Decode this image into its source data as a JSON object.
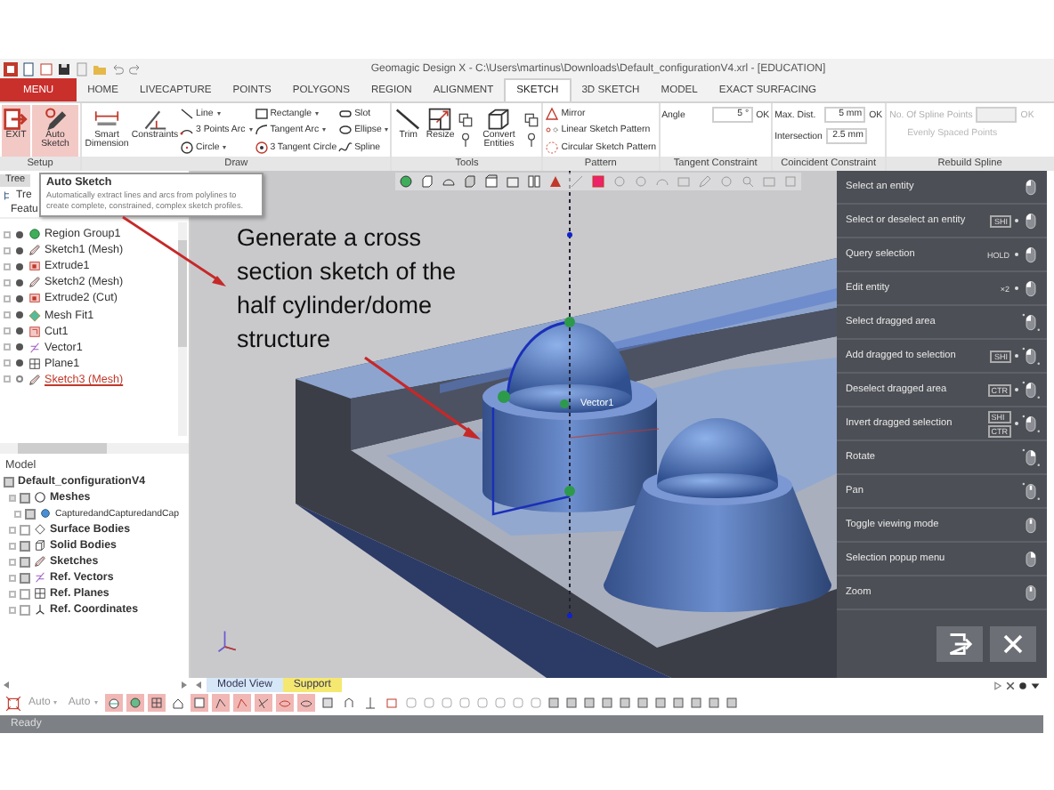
{
  "window": {
    "title": "Geomagic Design X - C:\\Users\\martinus\\Downloads\\Default_configurationV4.xrl - [EDUCATION]"
  },
  "ribbon_tabs": [
    {
      "label": "MENU",
      "kind": "menu",
      "selected": false
    },
    {
      "label": "HOME",
      "kind": "tab",
      "selected": false
    },
    {
      "label": "LIVECAPTURE",
      "kind": "tab",
      "selected": false
    },
    {
      "label": "POINTS",
      "kind": "tab",
      "selected": false
    },
    {
      "label": "POLYGONS",
      "kind": "tab",
      "selected": false
    },
    {
      "label": "REGION",
      "kind": "tab",
      "selected": false
    },
    {
      "label": "ALIGNMENT",
      "kind": "tab",
      "selected": false
    },
    {
      "label": "SKETCH",
      "kind": "tab",
      "selected": true
    },
    {
      "label": "3D SKETCH",
      "kind": "tab",
      "selected": false
    },
    {
      "label": "MODEL",
      "kind": "tab",
      "selected": false
    },
    {
      "label": "EXACT SURFACING",
      "kind": "tab",
      "selected": false
    }
  ],
  "ribbon_groups": [
    {
      "title": "Setup",
      "items": [
        {
          "kind": "large",
          "label": "EXIT",
          "highlighted": true
        },
        {
          "kind": "large",
          "label": "Auto Sketch",
          "highlighted": true
        }
      ]
    },
    {
      "title": "Draw",
      "items": [
        {
          "kind": "large",
          "label": "Smart Dimension",
          "highlighted": false
        },
        {
          "kind": "large",
          "label": "Constraints",
          "highlighted": false
        },
        {
          "kind": "stack",
          "buttons": [
            {
              "label": "Line",
              "dropdown": true
            },
            {
              "label": "3 Points Arc",
              "dropdown": true
            },
            {
              "label": "Circle",
              "dropdown": true
            }
          ]
        },
        {
          "kind": "stack",
          "buttons": [
            {
              "label": "Rectangle",
              "dropdown": true
            },
            {
              "label": "Tangent Arc",
              "dropdown": true
            },
            {
              "label": "3 Tangent Circle",
              "dropdown": false
            }
          ]
        },
        {
          "kind": "stack",
          "buttons": [
            {
              "label": "Slot",
              "dropdown": false
            },
            {
              "label": "Ellipse",
              "dropdown": true
            },
            {
              "label": "Spline",
              "dropdown": false
            }
          ]
        }
      ]
    },
    {
      "title": "Tools",
      "items": [
        {
          "kind": "large",
          "label": "Trim",
          "highlighted": false
        },
        {
          "kind": "large",
          "label": "Resize",
          "highlighted": false
        },
        {
          "kind": "icon_stack"
        },
        {
          "kind": "large",
          "label": "Convert Entities",
          "highlighted": false
        },
        {
          "kind": "icon_stack"
        }
      ]
    },
    {
      "title": "Pattern",
      "items": [
        {
          "kind": "stack",
          "buttons": [
            {
              "label": "Mirror",
              "dropdown": false
            },
            {
              "label": "Linear Sketch Pattern",
              "dropdown": false
            },
            {
              "label": "Circular Sketch Pattern",
              "dropdown": false
            }
          ]
        }
      ]
    },
    {
      "title": "Tangent Constraint",
      "items": [
        {
          "kind": "form",
          "rows": [
            {
              "kind": "field",
              "label": "Angle",
              "value": "5 °",
              "button": "OK",
              "disabled": false
            }
          ]
        }
      ]
    },
    {
      "title": "Coincident Constraint",
      "items": [
        {
          "kind": "form",
          "rows": [
            {
              "kind": "field",
              "label": "Max. Dist.",
              "value": "5 mm",
              "button": "OK",
              "disabled": false
            },
            {
              "kind": "field",
              "label": "Intersection",
              "value": "2.5 mm",
              "disabled": false
            }
          ]
        }
      ]
    },
    {
      "title": "Rebuild Spline",
      "items": [
        {
          "kind": "form",
          "rows": [
            {
              "kind": "field",
              "label": "No. Of Spline Points",
              "button": "OK",
              "disabled": true
            },
            {
              "kind": "option",
              "label": "Evenly Spaced Points",
              "disabled": true
            }
          ]
        }
      ]
    }
  ],
  "tooltip": {
    "title": "Auto Sketch",
    "text": "Automatically extract lines and arcs from polylines to create complete, constrained, complex sketch profiles."
  },
  "feature_panel": {
    "tab": "Tree",
    "toolbar_label": "Tre",
    "column_label": "Featu",
    "items": [
      {
        "label": "Region Group1",
        "kind": "region",
        "visible": true,
        "editing": false
      },
      {
        "label": "Sketch1 (Mesh)",
        "kind": "sketch",
        "visible": true,
        "editing": false
      },
      {
        "label": "Extrude1",
        "kind": "extrude",
        "visible": true,
        "editing": false
      },
      {
        "label": "Sketch2 (Mesh)",
        "kind": "sketch",
        "visible": true,
        "editing": false
      },
      {
        "label": "Extrude2 (Cut)",
        "kind": "extrude",
        "visible": true,
        "editing": false
      },
      {
        "label": "Mesh Fit1",
        "kind": "meshfit",
        "visible": true,
        "editing": false
      },
      {
        "label": "Cut1",
        "kind": "cut",
        "visible": true,
        "editing": false
      },
      {
        "label": "Vector1",
        "kind": "vector",
        "visible": true,
        "editing": false
      },
      {
        "label": "Plane1",
        "kind": "plane",
        "visible": true,
        "editing": false
      },
      {
        "label": "Sketch3 (Mesh)",
        "kind": "sketch",
        "visible": false,
        "editing": true
      }
    ]
  },
  "model_panel": {
    "title": "Model",
    "root": {
      "label": "Default_configurationV4",
      "visible": true,
      "children": [
        {
          "label": "Meshes",
          "kind": "mesh",
          "visible": true,
          "expanded": true,
          "children": [
            {
              "label": "CapturedandCapturedandCap",
              "kind": "mesh_item",
              "visible": true,
              "expanded": false
            }
          ]
        },
        {
          "label": "Surface Bodies",
          "kind": "surface",
          "visible": false,
          "expanded": false
        },
        {
          "label": "Solid Bodies",
          "kind": "solid",
          "visible": true,
          "expanded": false
        },
        {
          "label": "Sketches",
          "kind": "sketch",
          "visible": true,
          "expanded": false
        },
        {
          "label": "Ref. Vectors",
          "kind": "vector",
          "visible": true,
          "expanded": false
        },
        {
          "label": "Ref. Planes",
          "kind": "plane",
          "visible": false,
          "expanded": false
        },
        {
          "label": "Ref. Coordinates",
          "kind": "coordinates",
          "visible": false,
          "expanded": false
        }
      ]
    }
  },
  "viewport": {
    "annotation": "Generate a cross section sketch of the half cylinder/dome structure",
    "entity_label": "Vector1"
  },
  "help_panel": {
    "items": [
      {
        "label": "Select an entity",
        "kind": "left"
      },
      {
        "label": "Select or deselect an entity",
        "keys": [
          {
            "text": "SHI",
            "kind": "box"
          }
        ],
        "kind": "left"
      },
      {
        "label": "Query selection",
        "keys": [
          {
            "text": "HOLD",
            "kind": "plain"
          }
        ],
        "kind": "left"
      },
      {
        "label": "Edit entity",
        "keys": [
          {
            "text": "×2",
            "kind": "plain"
          }
        ],
        "kind": "left"
      },
      {
        "label": "Select dragged area",
        "kind": "left_drag"
      },
      {
        "label": "Add dragged to selection",
        "keys": [
          {
            "text": "SHI",
            "kind": "box"
          }
        ],
        "kind": "left_drag"
      },
      {
        "label": "Deselect dragged area",
        "keys": [
          {
            "text": "CTR",
            "kind": "box"
          }
        ],
        "kind": "left_drag"
      },
      {
        "label": "Invert dragged selection",
        "keys": [
          {
            "text": "SHI",
            "kind": "box"
          },
          {
            "text": "CTR",
            "kind": "box"
          }
        ],
        "kind": "left_drag"
      },
      {
        "label": "Rotate",
        "kind": "right_drag"
      },
      {
        "label": "Pan",
        "kind": "middle_drag"
      },
      {
        "label": "Toggle viewing mode",
        "kind": "middle"
      },
      {
        "label": "Selection popup menu",
        "kind": "right"
      },
      {
        "label": "Zoom",
        "kind": "wheel"
      }
    ]
  },
  "view_tabs": [
    {
      "label": "Model View",
      "color": "#d6e7f7"
    },
    {
      "label": "Support",
      "color": "#f5e870"
    }
  ],
  "bottom_toolbar": {
    "dropdowns": [
      "Auto",
      "Auto"
    ],
    "toggles": [
      {
        "on": true
      },
      {
        "on": true
      },
      {
        "on": true
      },
      {
        "on": false
      },
      {
        "on": true
      },
      {
        "on": true
      },
      {
        "on": true
      },
      {
        "on": true
      },
      {
        "on": true
      },
      {
        "on": true
      },
      {
        "on": false
      },
      {
        "on": false
      },
      {
        "on": false
      },
      {
        "on": false
      }
    ]
  },
  "status_bar": {
    "text": "Ready"
  }
}
